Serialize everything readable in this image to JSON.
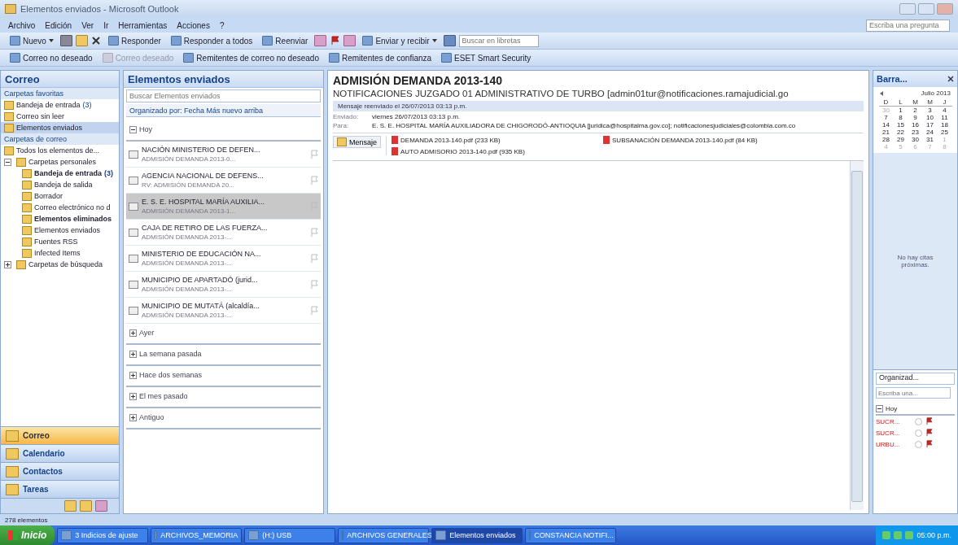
{
  "window": {
    "title": "Elementos enviados - Microsoft Outlook"
  },
  "menu": [
    "Archivo",
    "Edición",
    "Ver",
    "Ir",
    "Herramientas",
    "Acciones",
    "?"
  ],
  "help_search": {
    "placeholder": "Escriba una pregunta"
  },
  "toolbar": [
    {
      "label": "Nuevo",
      "dropdown": true
    },
    {
      "label": "Responder",
      "dropdown": false
    },
    {
      "label": "Responder a todos",
      "dropdown": false
    },
    {
      "label": "Reenviar",
      "dropdown": false
    },
    {
      "label": "Enviar y recibir",
      "dropdown": true
    }
  ],
  "address_search": {
    "placeholder": "Buscar en libretas"
  },
  "toolbar2": [
    {
      "label": "Correo no deseado",
      "disabled": false
    },
    {
      "label": "Correo deseado",
      "disabled": true
    },
    {
      "label": "Remitentes de correo no deseado",
      "disabled": false
    },
    {
      "label": "Remitentes de confianza",
      "disabled": false
    },
    {
      "label": "ESET Smart Security",
      "disabled": false
    }
  ],
  "nav": {
    "title": "Correo",
    "favorites_title": "Carpetas favoritas",
    "favorites": [
      {
        "label": "Bandeja de entrada",
        "count": "(3)",
        "selected": false
      },
      {
        "label": "Correo sin leer",
        "selected": false
      },
      {
        "label": "Elementos enviados",
        "selected": true
      }
    ],
    "folders_title": "Carpetas de correo",
    "all_items": "Todos los elementos de...",
    "tree": [
      {
        "label": "Carpetas personales",
        "unread": false,
        "expanded": true,
        "children": [
          {
            "label": "Bandeja de entrada",
            "count": "(3)",
            "unread": true
          },
          {
            "label": "Bandeja de salida",
            "unread": false
          },
          {
            "label": "Borrador",
            "unread": false
          },
          {
            "label": "Correo electrónico no d",
            "unread": false
          },
          {
            "label": "Elementos eliminados",
            "unread": true
          },
          {
            "label": "Elementos enviados",
            "unread": false
          },
          {
            "label": "Fuentes RSS",
            "unread": false
          },
          {
            "label": "Infected Items",
            "unread": false
          }
        ]
      },
      {
        "label": "Carpetas de búsqueda",
        "unread": false,
        "expanded": false
      }
    ],
    "buttons": [
      {
        "label": "Correo",
        "selected": true
      },
      {
        "label": "Calendario",
        "selected": false
      },
      {
        "label": "Contactos",
        "selected": false
      },
      {
        "label": "Tareas",
        "selected": false
      }
    ]
  },
  "list": {
    "title": "Elementos enviados",
    "search": {
      "placeholder": "Buscar Elementos enviados"
    },
    "arrange": "Organizado por: Fecha   Más nuevo arriba",
    "groups": [
      {
        "label": "Hoy",
        "expanded": true,
        "items": [
          {
            "to": "NACIÓN MINISTERIO DE DEFEN...",
            "subject": "ADMISIÓN DEMANDA 2013-0...",
            "selected": false
          },
          {
            "to": "AGENCIA NACIONAL DE DEFENS...",
            "subject": "RV: ADMISIÓN DEMANDA 20...",
            "selected": false
          },
          {
            "to": "E. S. E. HOSPITAL MARÍA AUXILIA...",
            "subject": "ADMISIÓN DEMANDA 2013-1...",
            "selected": true
          },
          {
            "to": "CAJA DE RETIRO DE LAS FUERZA...",
            "subject": "ADMISIÓN DEMANDA 2013-...",
            "selected": false
          },
          {
            "to": "MINISTERIO DE EDUCACIÓN NA...",
            "subject": "ADMISIÓN DEMANDA 2013-...",
            "selected": false
          },
          {
            "to": "MUNICIPIO DE APARTADÓ (jurid...",
            "subject": "ADMISIÓN DEMANDA 2013-...",
            "selected": false
          },
          {
            "to": "MUNICIPIO DE MUTATÁ (alcaldía...",
            "subject": "ADMISIÓN DEMANDA 2013-...",
            "selected": false
          }
        ]
      },
      {
        "label": "Ayer",
        "expanded": false
      },
      {
        "label": "La semana pasada",
        "expanded": false
      },
      {
        "label": "Hace dos semanas",
        "expanded": false
      },
      {
        "label": "El mes pasado",
        "expanded": false
      },
      {
        "label": "Antiguo",
        "expanded": false
      }
    ]
  },
  "message": {
    "subject": "ADMISIÓN DEMANDA 2013-140",
    "from": "NOTIFICACIONES JUZGADO 01 ADMINISTRATIVO DE TURBO [admin01tur@notificaciones.ramajudicial.go",
    "info": "Mensaje reenviado el 26/07/2013 03:13 p.m.",
    "fields": [
      {
        "label": "Enviado:",
        "value": "viernes 26/07/2013 03:13 p.m."
      },
      {
        "label": "Para:",
        "value": "E. S. E. HOSPITAL MARÍA AUXILIADORA DE CHIGORODÓ-ANTIOQUIA [juridica@hospitalma.gov.co]; notificacionesjudiciales@colombia.com.co"
      }
    ],
    "message_tab": "Mensaje",
    "attachments": [
      "DEMANDA 2013-140.pdf (233 KB)",
      "SUBSANACIÓN DEMANDA 2013-140.pdf (84 KB)",
      "AUTO ADMISORIO 2013-140.pdf (935 KB)"
    ]
  },
  "todo": {
    "title": "Barra...",
    "calendar": {
      "month": "Julio 2013",
      "weekdays": [
        "D",
        "L",
        "M",
        "M",
        "J"
      ],
      "weeks": [
        [
          {
            "day": "30",
            "other_month": true
          },
          {
            "day": "1",
            "other_month": false
          },
          {
            "day": "2",
            "other_month": false
          },
          {
            "day": "3",
            "other_month": false
          },
          {
            "day": "4",
            "other_month": false
          }
        ],
        [
          {
            "day": "7",
            "other_month": false
          },
          {
            "day": "8",
            "other_month": false
          },
          {
            "day": "9",
            "other_month": false
          },
          {
            "day": "10",
            "other_month": false
          },
          {
            "day": "11",
            "other_month": false
          }
        ],
        [
          {
            "day": "14",
            "other_month": false
          },
          {
            "day": "15",
            "other_month": false
          },
          {
            "day": "16",
            "other_month": false
          },
          {
            "day": "17",
            "other_month": false
          },
          {
            "day": "18",
            "other_month": false
          }
        ],
        [
          {
            "day": "21",
            "other_month": false
          },
          {
            "day": "22",
            "other_month": false
          },
          {
            "day": "23",
            "other_month": false
          },
          {
            "day": "24",
            "other_month": false
          },
          {
            "day": "25",
            "other_month": false
          }
        ],
        [
          {
            "day": "28",
            "other_month": false
          },
          {
            "day": "29",
            "other_month": false
          },
          {
            "day": "30",
            "other_month": false
          },
          {
            "day": "31",
            "other_month": false
          },
          {
            "day": "1",
            "other_month": true
          }
        ],
        [
          {
            "day": "4",
            "other_month": true
          },
          {
            "day": "5",
            "other_month": true
          },
          {
            "day": "6",
            "other_month": true
          },
          {
            "day": "7",
            "other_month": true
          },
          {
            "day": "8",
            "other_month": true
          }
        ]
      ]
    },
    "appointments": "No hay citas próximas.",
    "arrange": "Organizad...",
    "task_input": {
      "placeholder": "Escriba una..."
    },
    "task_group": {
      "label": "Hoy",
      "expanded": true
    },
    "tasks": [
      {
        "label": "SUCR...",
        "overdue": true
      },
      {
        "label": "SUCR...",
        "overdue": true
      },
      {
        "label": "URBU...",
        "overdue": true
      }
    ]
  },
  "status_bar": "278 elementos",
  "taskbar": {
    "start": "Inicio",
    "items": [
      {
        "label": "3 Indicios de ajuste",
        "selected": false
      },
      {
        "label": "ARCHIVOS_MEMORIA",
        "selected": false
      },
      {
        "label": "(H:) USB",
        "selected": false
      },
      {
        "label": "ARCHIVOS GENERALES",
        "selected": false
      },
      {
        "label": "Elementos enviados",
        "selected": true
      },
      {
        "label": "CONSTANCIA NOTIFI...",
        "selected": false
      }
    ],
    "clock": "05:00 p.m."
  }
}
